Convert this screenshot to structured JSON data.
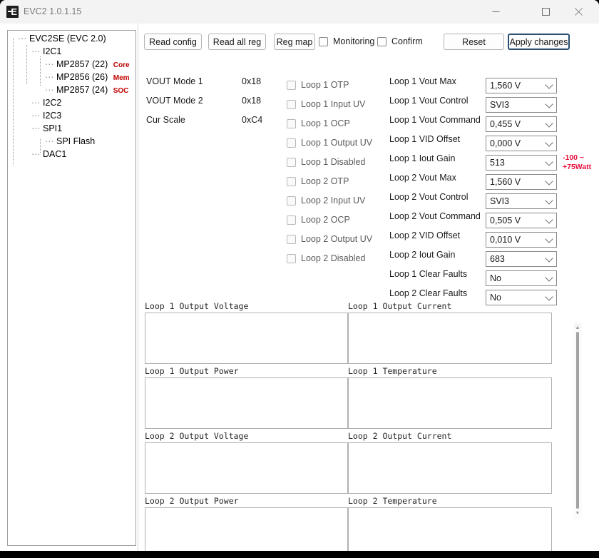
{
  "window": {
    "title": "EVC2 1.0.1.15",
    "icon": "app-icon-evc2",
    "minimize_icon": "minimize-icon",
    "maximize_icon": "maximize-icon",
    "close_icon": "close-icon"
  },
  "tree": {
    "nodes": [
      {
        "label": "EVC2SE (EVC 2.0)",
        "depth": 0,
        "tag": ""
      },
      {
        "label": "I2C1",
        "depth": 1,
        "tag": ""
      },
      {
        "label": "MP2857 (22)",
        "depth": 2,
        "tag": "Core"
      },
      {
        "label": "MP2856 (26)",
        "depth": 2,
        "tag": "Mem"
      },
      {
        "label": "MP2857 (24)",
        "depth": 2,
        "tag": "SOC"
      },
      {
        "label": "I2C2",
        "depth": 1,
        "tag": ""
      },
      {
        "label": "I2C3",
        "depth": 1,
        "tag": ""
      },
      {
        "label": "SPI1",
        "depth": 1,
        "tag": ""
      },
      {
        "label": "SPI Flash",
        "depth": 2,
        "tag": ""
      },
      {
        "label": "DAC1",
        "depth": 1,
        "tag": ""
      }
    ]
  },
  "toolbar": {
    "read_config": "Read config",
    "read_all_reg": "Read all reg",
    "reg_map": "Reg map",
    "monitoring": "Monitoring",
    "confirm": "Confirm",
    "reset": "Reset",
    "apply_changes": "Apply changes",
    "monitoring_checked": false,
    "confirm_checked": false
  },
  "registers": [
    {
      "label": "VOUT Mode 1",
      "value": "0x18"
    },
    {
      "label": "VOUT Mode 2",
      "value": "0x18"
    },
    {
      "label": "Cur Scale",
      "value": "0xC4"
    }
  ],
  "status_flags": [
    {
      "label": "Loop 1 OTP",
      "checked": false
    },
    {
      "label": "Loop 1 Input UV",
      "checked": false
    },
    {
      "label": "Loop 1 OCP",
      "checked": false
    },
    {
      "label": "Loop 1 Output UV",
      "checked": false
    },
    {
      "label": "Loop 1 Disabled",
      "checked": false
    },
    {
      "label": "Loop 2 OTP",
      "checked": false
    },
    {
      "label": "Loop 2 Input UV",
      "checked": false
    },
    {
      "label": "Loop 2 OCP",
      "checked": false
    },
    {
      "label": "Loop 2 Output UV",
      "checked": false
    },
    {
      "label": "Loop 2 Disabled",
      "checked": false
    }
  ],
  "settings": [
    {
      "label": "Loop 1 Vout Max",
      "value": "1,560 V"
    },
    {
      "label": "Loop 1 Vout Control",
      "value": "SVI3"
    },
    {
      "label": "Loop 1 Vout Command",
      "value": "0,455 V"
    },
    {
      "label": "Loop 1 VID Offset",
      "value": "0,000 V"
    },
    {
      "label": "Loop 1 Iout Gain",
      "value": "513"
    },
    {
      "label": "Loop 2 Vout Max",
      "value": "1,560 V"
    },
    {
      "label": "Loop 2 Vout Control",
      "value": "SVI3"
    },
    {
      "label": "Loop 2 Vout Command",
      "value": "0,505 V"
    },
    {
      "label": "Loop 2 VID Offset",
      "value": "0,010 V"
    },
    {
      "label": "Loop 2 Iout Gain",
      "value": "683"
    },
    {
      "label": "Loop 1 Clear Faults",
      "value": "No"
    },
    {
      "label": "Loop 2 Clear Faults",
      "value": "No"
    }
  ],
  "annotation": {
    "line1": "-100 ~",
    "line2": "+75Watt",
    "color": "#e8113c"
  },
  "graphs": [
    {
      "label": "Loop 1 Output Voltage"
    },
    {
      "label": "Loop 1 Output Current"
    },
    {
      "label": "Loop 1 Output Power"
    },
    {
      "label": "Loop 1 Temperature"
    },
    {
      "label": "Loop 2 Output Voltage"
    },
    {
      "label": "Loop 2 Output Current"
    },
    {
      "label": "Loop 2 Output Power"
    },
    {
      "label": "Loop 2 Temperature"
    }
  ],
  "scrollbar": {
    "up_arrow": "scroll-up-icon",
    "down_arrow": "scroll-down-icon"
  }
}
